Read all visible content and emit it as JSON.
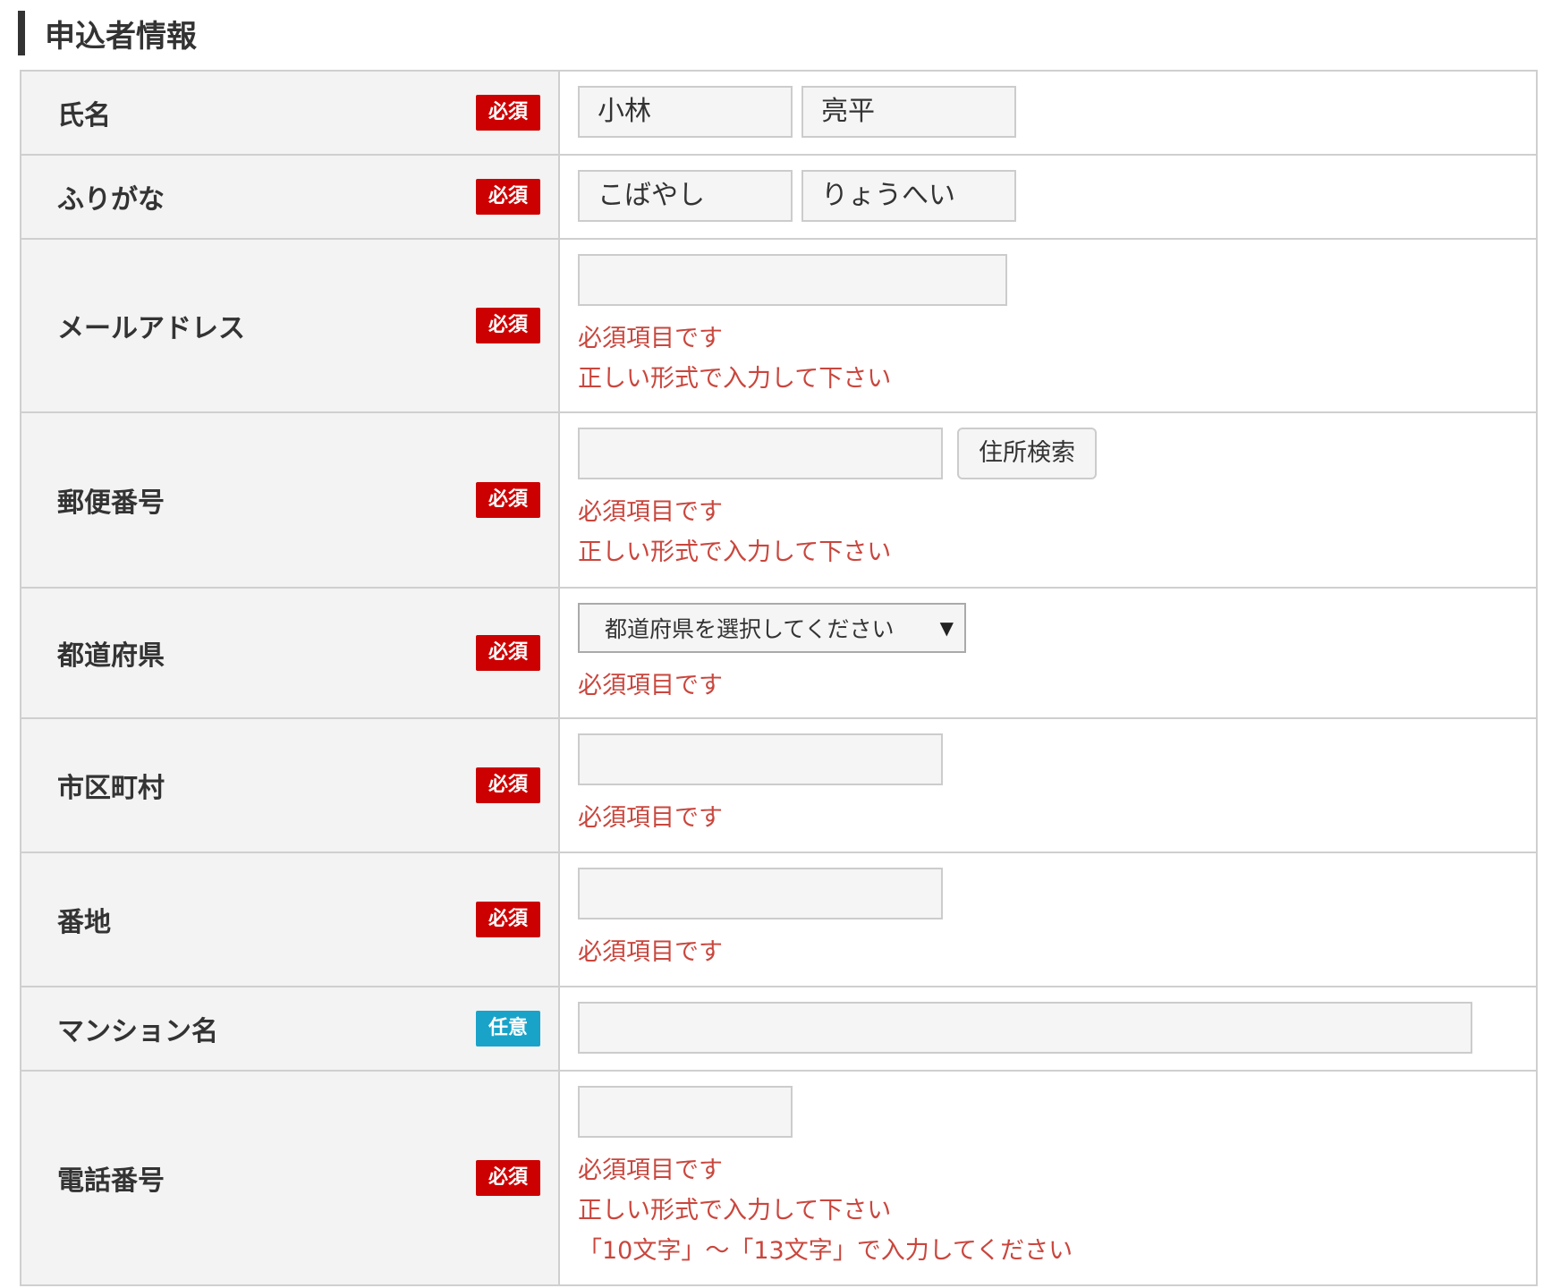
{
  "section": {
    "title": "申込者情報"
  },
  "badges": {
    "required": "必須",
    "optional": "任意"
  },
  "fields": {
    "name": {
      "label": "氏名",
      "last_value": "小林",
      "first_value": "亮平"
    },
    "furigana": {
      "label": "ふりがな",
      "last_value": "こばやし",
      "first_value": "りょうへい"
    },
    "email": {
      "label": "メールアドレス",
      "value": "",
      "errors": [
        "必須項目です",
        "正しい形式で入力して下さい"
      ]
    },
    "postal": {
      "label": "郵便番号",
      "value": "",
      "button_label": "住所検索",
      "errors": [
        "必須項目です",
        "正しい形式で入力して下さい"
      ]
    },
    "prefecture": {
      "label": "都道府県",
      "selected": "都道府県を選択してください",
      "errors": [
        "必須項目です"
      ]
    },
    "city": {
      "label": "市区町村",
      "value": "",
      "errors": [
        "必須項目です"
      ]
    },
    "address": {
      "label": "番地",
      "value": "",
      "errors": [
        "必須項目です"
      ]
    },
    "building": {
      "label": "マンション名",
      "value": ""
    },
    "phone": {
      "label": "電話番号",
      "value": "",
      "errors": [
        "必須項目です",
        "正しい形式で入力して下さい",
        "「10文字」～「13文字」で入力してください"
      ]
    }
  },
  "colors": {
    "required_badge": "#cc0000",
    "optional_badge": "#1aa3c8",
    "error_text": "#c9463d"
  }
}
